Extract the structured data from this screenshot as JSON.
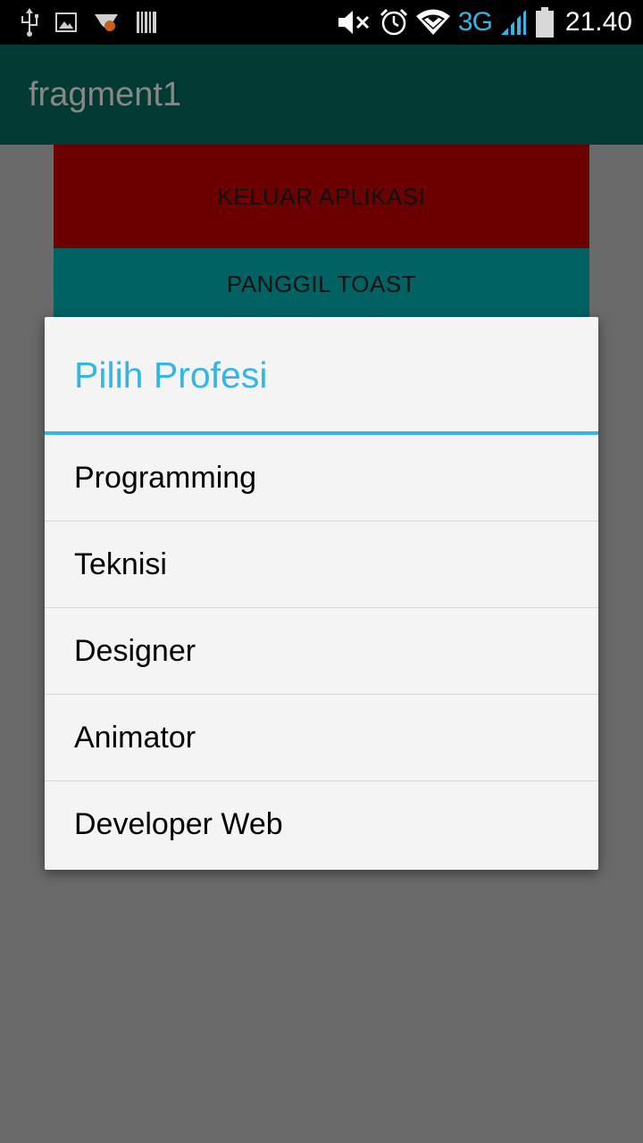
{
  "status_bar": {
    "left_icons": [
      "usb-icon",
      "image-icon",
      "app-notification-icon",
      "barcode-icon"
    ],
    "right_icons": [
      "mute-icon",
      "alarm-icon",
      "wifi-icon",
      "signal-icon",
      "battery-icon"
    ],
    "network_type": "3G",
    "time": "21.40",
    "accent_color": "#33b5e5"
  },
  "action_bar": {
    "title": "fragment1",
    "background_color": "#003a33"
  },
  "content": {
    "exit_button_label": "KELUAR APLIKASI",
    "exit_button_color": "#6b0000",
    "toast_button_label": "PANGGIL TOAST",
    "toast_button_color": "#006262"
  },
  "dialog": {
    "title": "Pilih Profesi",
    "title_color": "#33b5e5",
    "items": [
      {
        "label": "Programming"
      },
      {
        "label": "Teknisi"
      },
      {
        "label": "Designer"
      },
      {
        "label": "Animator"
      },
      {
        "label": "Developer Web"
      }
    ]
  }
}
